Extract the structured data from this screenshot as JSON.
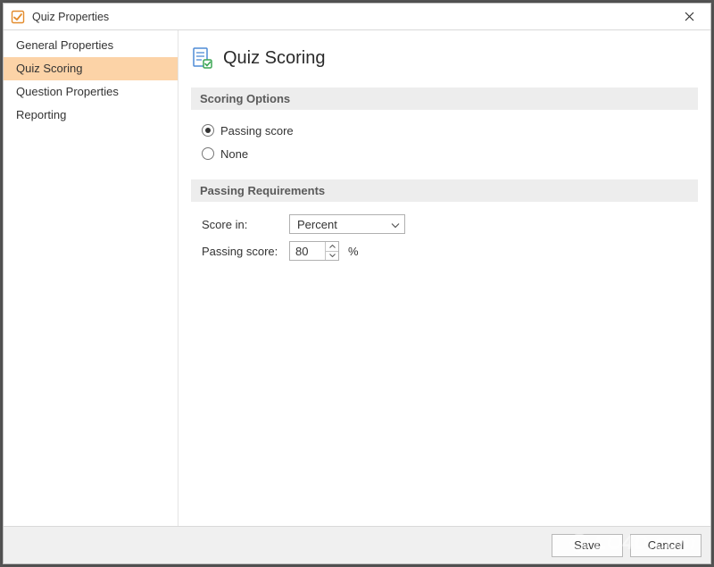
{
  "window": {
    "title": "Quiz Properties"
  },
  "sidebar": {
    "items": [
      {
        "label": "General Properties",
        "selected": false
      },
      {
        "label": "Quiz Scoring",
        "selected": true
      },
      {
        "label": "Question Properties",
        "selected": false
      },
      {
        "label": "Reporting",
        "selected": false
      }
    ]
  },
  "page": {
    "title": "Quiz Scoring",
    "sections": {
      "scoring_options": {
        "header": "Scoring Options",
        "radios": [
          {
            "label": "Passing score",
            "checked": true
          },
          {
            "label": "None",
            "checked": false
          }
        ]
      },
      "passing_requirements": {
        "header": "Passing Requirements",
        "score_in": {
          "label": "Score in:",
          "value": "Percent"
        },
        "passing_score": {
          "label": "Passing score:",
          "value": "80",
          "unit": "%"
        }
      }
    }
  },
  "buttons": {
    "save": "Save",
    "cancel": "Cancel"
  },
  "watermark": "LO4D.com"
}
